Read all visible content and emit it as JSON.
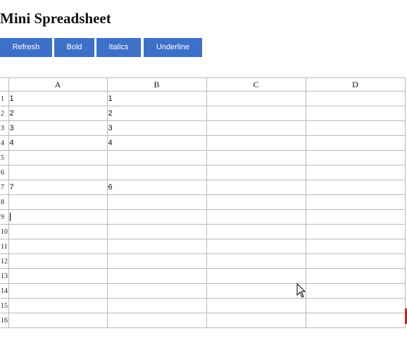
{
  "page": {
    "title": "Mini Spreadsheet"
  },
  "toolbar": {
    "buttons": [
      {
        "id": "refresh",
        "label": "Refresh"
      },
      {
        "id": "bold",
        "label": "Bold"
      },
      {
        "id": "italics",
        "label": "Italics"
      },
      {
        "id": "underline",
        "label": "Underline"
      }
    ]
  },
  "sheet": {
    "columns": [
      "A",
      "B",
      "C",
      "D"
    ],
    "rows": [
      {
        "num": "1",
        "cells": [
          "1",
          "1",
          "",
          ""
        ]
      },
      {
        "num": "2",
        "cells": [
          "2",
          "2",
          "",
          ""
        ]
      },
      {
        "num": "3",
        "cells": [
          "3",
          "3",
          "",
          ""
        ]
      },
      {
        "num": "4",
        "cells": [
          "4",
          "4",
          "",
          ""
        ]
      },
      {
        "num": "5",
        "cells": [
          "",
          "",
          "",
          ""
        ]
      },
      {
        "num": "6",
        "cells": [
          "",
          "",
          "",
          ""
        ]
      },
      {
        "num": "7",
        "cells": [
          "7",
          "6",
          "",
          ""
        ]
      },
      {
        "num": "8",
        "cells": [
          "",
          "",
          "",
          ""
        ]
      },
      {
        "num": "9",
        "cells": [
          "",
          "",
          "",
          ""
        ]
      },
      {
        "num": "10",
        "cells": [
          "",
          "",
          "",
          ""
        ]
      },
      {
        "num": "11",
        "cells": [
          "",
          "",
          "",
          ""
        ]
      },
      {
        "num": "12",
        "cells": [
          "",
          "",
          "",
          ""
        ]
      },
      {
        "num": "13",
        "cells": [
          "",
          "",
          "",
          ""
        ]
      },
      {
        "num": "14",
        "cells": [
          "",
          "",
          "",
          ""
        ]
      },
      {
        "num": "15",
        "cells": [
          "",
          "",
          "",
          ""
        ]
      },
      {
        "num": "16",
        "cells": [
          "",
          "",
          "",
          ""
        ]
      }
    ],
    "active_cell": "A9"
  },
  "colors": {
    "button_bg": "#3d70c9",
    "button_text": "#ffffff",
    "grid_line": "#b9b9b9"
  },
  "icons": {
    "mouse_pointer": "arrow-cursor-icon"
  }
}
